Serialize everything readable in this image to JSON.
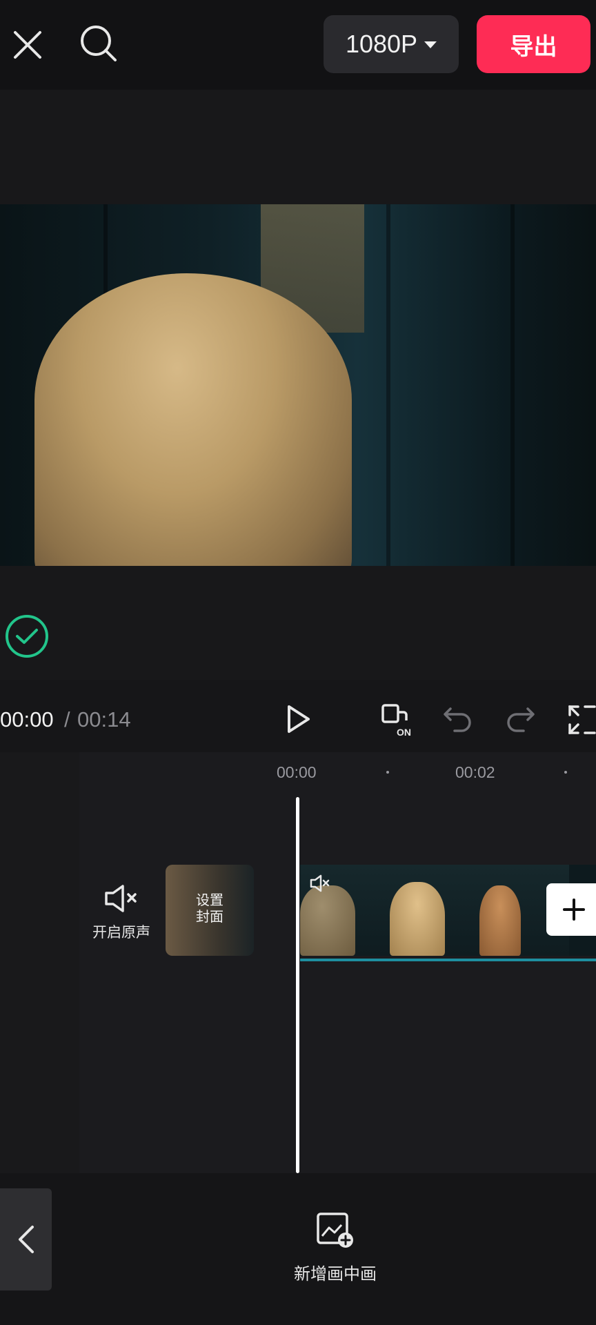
{
  "header": {
    "resolution": "1080P",
    "export_label": "导出"
  },
  "playback": {
    "current_time": "00:00",
    "separator": "/",
    "total_time": "00:14",
    "auto_badge": "ON"
  },
  "ruler": {
    "labels": [
      "00:00",
      "00:02"
    ]
  },
  "track": {
    "mute_label": "开启原声",
    "cover_label_line1": "设置",
    "cover_label_line2": "封面"
  },
  "toolbar": {
    "pip_label": "新增画中画"
  },
  "colors": {
    "accent": "#fe2c55",
    "check": "#22c58b",
    "clip_underline": "#1e8fa0"
  }
}
